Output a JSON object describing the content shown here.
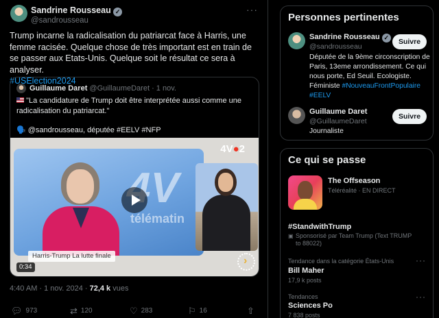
{
  "tweet": {
    "author_name": "Sandrine Rousseau",
    "author_handle": "@sandrousseau",
    "text": "Trump incarne la radicalisation du patriarcat face à Harris, une femme racisée. Quelque chose de très important est en train de se passer aux Etats-Unis. Quelque soit le résultat ce sera à analyser.",
    "hashtag": "#USElection2024",
    "timestamp": "4:40 AM · 1 nov. 2024",
    "views_count": "72,4 k",
    "views_label": "vues",
    "replies": "973",
    "reposts": "120",
    "likes": "283",
    "bookmarks": "16"
  },
  "quote": {
    "author_name": "Guillaume Daret",
    "author_handle": "@GuillaumeDaret",
    "date": "· 1 nov.",
    "text_line1": "\"La candidature de Trump doit être interprétée aussi comme une radicalisation du patriarcat.\"",
    "text_line2": "🗣️ @sandrousseau, députée #EELV #NFP",
    "video": {
      "channel_prefix": "4V",
      "channel_suffix": "2",
      "studio_logo": "4V",
      "studio_sub": "télématin",
      "lower_third": "Harris-Trump  La lutte finale",
      "duration": "0:34"
    }
  },
  "relevant": {
    "title": "Personnes pertinentes",
    "follow_label": "Suivre",
    "people": [
      {
        "name": "Sandrine Rousseau",
        "handle": "@sandrousseau",
        "bio": "Députée de la 9ème circonscription de Paris, 13eme arrondissement. Ce qui nous porte, Ed Seuil. Ecologiste. Féministe",
        "bio_tags": "#NouveauFrontPopulaire #EELV"
      },
      {
        "name": "Guillaume Daret",
        "handle": "@GuillaumeDaret",
        "bio": "Journaliste"
      }
    ]
  },
  "trends": {
    "title": "Ce qui se passe",
    "items": [
      {
        "title": "The Offseason",
        "sub": "Téléréalité · EN DIRECT"
      },
      {
        "title": "#StandwithTrump",
        "sub": "Sponsorisé par Team Trump (Text TRUMP to 88022)"
      },
      {
        "category": "Tendance dans la catégorie États-Unis",
        "title": "Bill Maher",
        "count": "17,9 k posts"
      },
      {
        "category": "Tendances",
        "title": "Sciences Po",
        "count": "7 838 posts"
      }
    ]
  },
  "icons": {
    "more": "more-icon",
    "reply": "reply-icon",
    "repost": "repost-icon",
    "like": "like-icon",
    "bookmark": "bookmark-icon",
    "share": "share-icon",
    "verified": "verified-icon",
    "play": "play-icon"
  }
}
